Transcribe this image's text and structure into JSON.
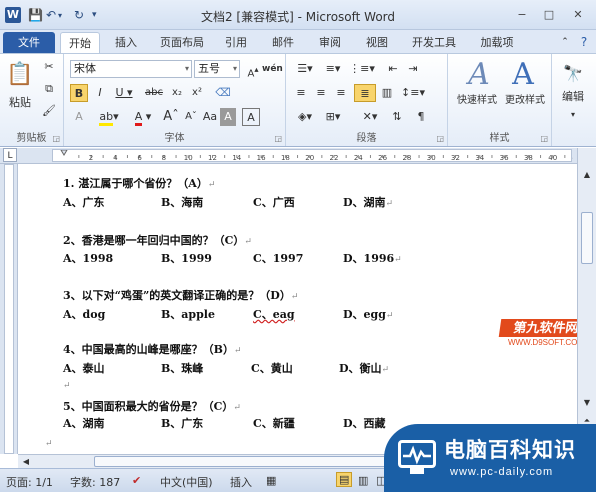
{
  "window": {
    "app_icon": "W",
    "title": "文档2 [兼容模式] - Microsoft Word",
    "controls": [
      "−",
      "□",
      "✕"
    ]
  },
  "tabs": [
    "文件",
    "开始",
    "插入",
    "页面布局",
    "引用",
    "邮件",
    "审阅",
    "视图",
    "开发工具",
    "加载项"
  ],
  "ribbon": {
    "clipboard": {
      "paste": "粘贴",
      "label": "剪贴板"
    },
    "font": {
      "name": "宋体",
      "size": "五号",
      "wen": "wén",
      "label": "字体"
    },
    "paragraph": {
      "label": "段落"
    },
    "styles": {
      "quick": "快速样式",
      "change": "更改样式",
      "label": "样式"
    },
    "edit": {
      "label": "编辑"
    }
  },
  "ruler": {
    "ticks": [
      "2",
      "4",
      "6",
      "8",
      "10",
      "12",
      "14",
      "16",
      "18",
      "20",
      "22",
      "24",
      "26",
      "28",
      "30",
      "32",
      "34",
      "36",
      "38",
      "40",
      "42"
    ]
  },
  "document": {
    "q1": {
      "text": "1.  湛江属于哪个省份？（A）",
      "opts": [
        "A、广东",
        "B、海南",
        "C、广西",
        "D、湖南"
      ]
    },
    "q2": {
      "text": "2、香港是哪一年回归中国的？（C）",
      "opts": [
        "A、1998",
        "B、1999",
        "C、1997",
        "D、1996"
      ]
    },
    "q3": {
      "text": "3、以下对“鸡蛋”的英文翻译正确的是？（D）",
      "opts": [
        "A、dog",
        "B、apple",
        "C、eag",
        "D、egg"
      ]
    },
    "q4": {
      "text": "4、中国最高的山峰是哪座？（B）",
      "opts": [
        "A、泰山",
        "B、珠峰",
        "C、黄山",
        "D、衡山"
      ]
    },
    "q5": {
      "text": "5、中国面积最大的省份是？（C）",
      "opts": [
        "A、湖南",
        "B、广东",
        "C、新疆",
        "D、西藏"
      ]
    },
    "mark": "↵"
  },
  "status": {
    "page": "页面: 1/1",
    "words": "字数: 187",
    "lang": "中文(中国)",
    "mode": "插入"
  },
  "watermark": {
    "logo_text": "第九软件网",
    "logo_url": "WWW.D9SOFT.COM"
  },
  "brand": {
    "title": "电脑百科知识",
    "url": "www.pc-daily.com"
  }
}
